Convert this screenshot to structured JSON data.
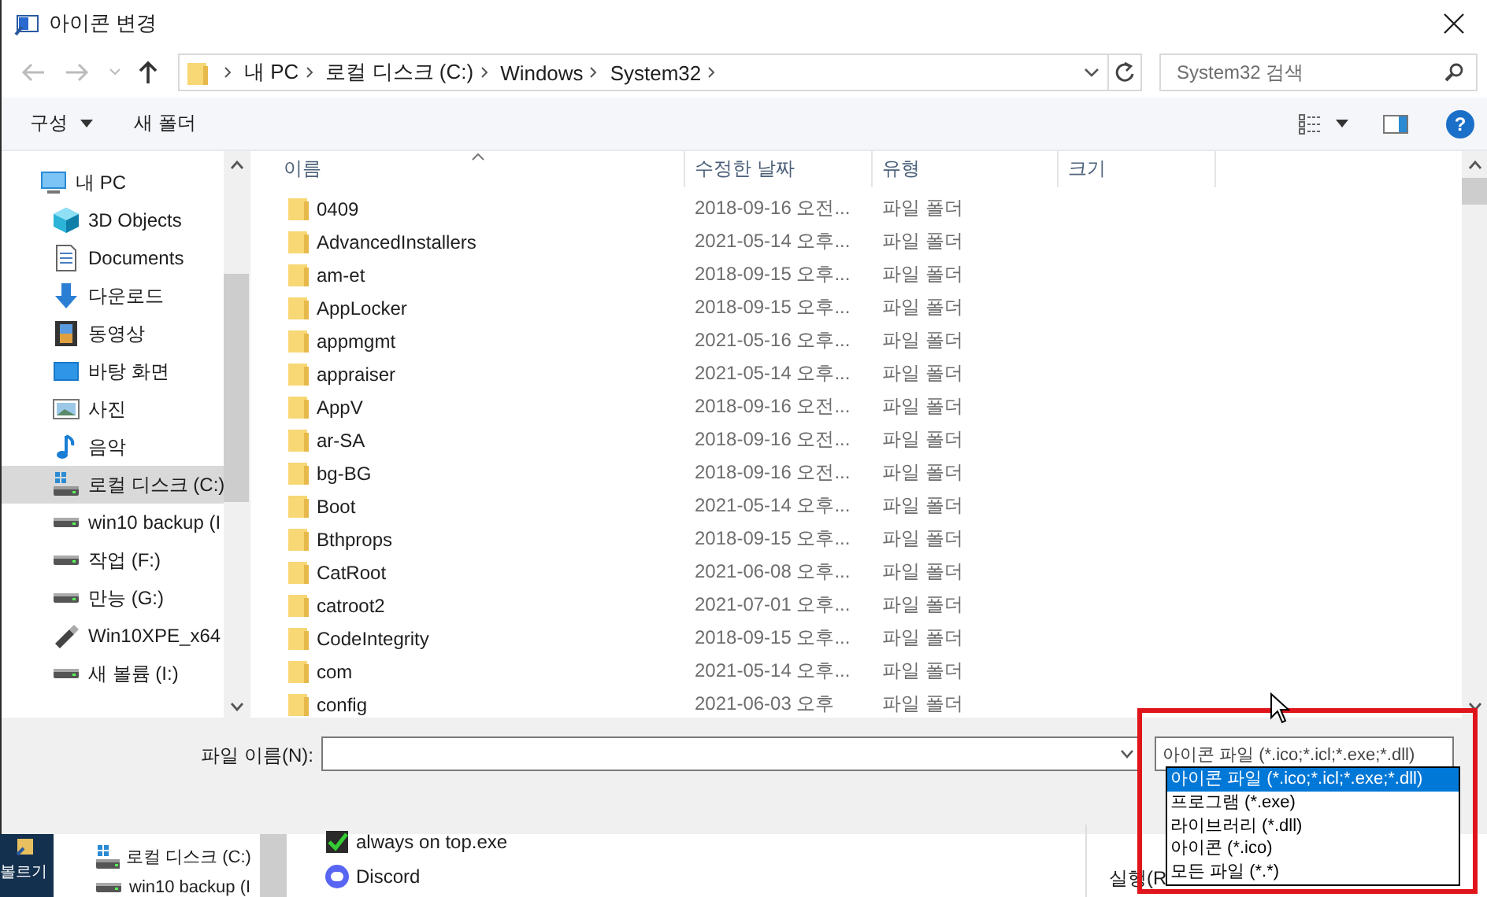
{
  "window": {
    "title": "아이콘 변경"
  },
  "address_bar": {
    "path": [
      "내 PC",
      "로컬 디스크 (C:)",
      "Windows",
      "System32"
    ],
    "search": {
      "placeholder": "System32 검색"
    }
  },
  "toolbar": {
    "buttons": [
      {
        "label": "구성",
        "menu": true
      },
      {
        "label": "새 폴더",
        "menu": false
      }
    ],
    "help": "?"
  },
  "sidebar": {
    "items": [
      {
        "label": "내 PC",
        "kind": "pc",
        "selected": false,
        "children": [
          {
            "label": "3D Objects",
            "kind": "cube",
            "selected": false
          },
          {
            "label": "Documents",
            "kind": "document",
            "selected": false
          },
          {
            "label": "다운로드",
            "kind": "download",
            "selected": false
          },
          {
            "label": "동영상",
            "kind": "video",
            "selected": false
          },
          {
            "label": "바탕 화면",
            "kind": "desktop",
            "selected": false
          },
          {
            "label": "사진",
            "kind": "picture",
            "selected": false
          },
          {
            "label": "음악",
            "kind": "music",
            "selected": false
          },
          {
            "label": "로컬 디스크 (C:)",
            "kind": "system-drive",
            "selected": true
          },
          {
            "label": "win10 backup (I",
            "kind": "drive",
            "selected": false
          },
          {
            "label": "작업 (F:)",
            "kind": "drive",
            "selected": false
          },
          {
            "label": "만능 (G:)",
            "kind": "drive",
            "selected": false
          },
          {
            "label": "Win10XPE_x64",
            "kind": "usb",
            "selected": false
          },
          {
            "label": "새 볼륨 (I:)",
            "kind": "drive",
            "selected": false
          }
        ]
      }
    ]
  },
  "file_list": {
    "columns": [
      "이름",
      "수정한 날짜",
      "유형",
      "크기"
    ],
    "rows": [
      {
        "name": "0409",
        "modified": "2018-09-16 오전...",
        "type": "파일 폴더"
      },
      {
        "name": "AdvancedInstallers",
        "modified": "2021-05-14 오후...",
        "type": "파일 폴더"
      },
      {
        "name": "am-et",
        "modified": "2018-09-15 오후...",
        "type": "파일 폴더"
      },
      {
        "name": "AppLocker",
        "modified": "2018-09-15 오후...",
        "type": "파일 폴더"
      },
      {
        "name": "appmgmt",
        "modified": "2021-05-16 오후...",
        "type": "파일 폴더"
      },
      {
        "name": "appraiser",
        "modified": "2021-05-14 오후...",
        "type": "파일 폴더"
      },
      {
        "name": "AppV",
        "modified": "2018-09-16 오전...",
        "type": "파일 폴더"
      },
      {
        "name": "ar-SA",
        "modified": "2018-09-16 오전...",
        "type": "파일 폴더"
      },
      {
        "name": "bg-BG",
        "modified": "2018-09-16 오전...",
        "type": "파일 폴더"
      },
      {
        "name": "Boot",
        "modified": "2021-05-14 오후...",
        "type": "파일 폴더"
      },
      {
        "name": "Bthprops",
        "modified": "2018-09-15 오후...",
        "type": "파일 폴더"
      },
      {
        "name": "CatRoot",
        "modified": "2021-06-08 오후...",
        "type": "파일 폴더"
      },
      {
        "name": "catroot2",
        "modified": "2021-07-01 오후...",
        "type": "파일 폴더"
      },
      {
        "name": "CodeIntegrity",
        "modified": "2018-09-15 오후...",
        "type": "파일 폴더"
      },
      {
        "name": "com",
        "modified": "2021-05-14 오후...",
        "type": "파일 폴더"
      },
      {
        "name": "config",
        "modified": "2021-06-03 오후",
        "type": "파일 폴더"
      }
    ]
  },
  "file_name": {
    "label": "파일 이름(N):"
  },
  "file_type": {
    "value": "아이콘 파일 (*.ico;*.icl;*.exe;*.dll)",
    "options": [
      {
        "label": "아이콘 파일 (*.ico;*.icl;*.exe;*.dll)",
        "selected": true
      },
      {
        "label": "프로그램 (*.exe)",
        "selected": false
      },
      {
        "label": "라이브러리 (*.dll)",
        "selected": false
      },
      {
        "label": "아이콘 (*.ico)",
        "selected": false
      },
      {
        "label": "모든 파일 (*.*)",
        "selected": false
      }
    ]
  },
  "background_window": {
    "sidebar_items": [
      {
        "label": "로컬 디스크 (C:)",
        "kind": "system-drive"
      },
      {
        "label": "win10 backup (I",
        "kind": "drive"
      }
    ],
    "files": [
      {
        "name": "always on top.exe",
        "kind": "check"
      },
      {
        "name": "Discord",
        "kind": "round-app"
      }
    ],
    "side_label": "실행(R"
  },
  "taskbar": {
    "label": "볼르기"
  }
}
